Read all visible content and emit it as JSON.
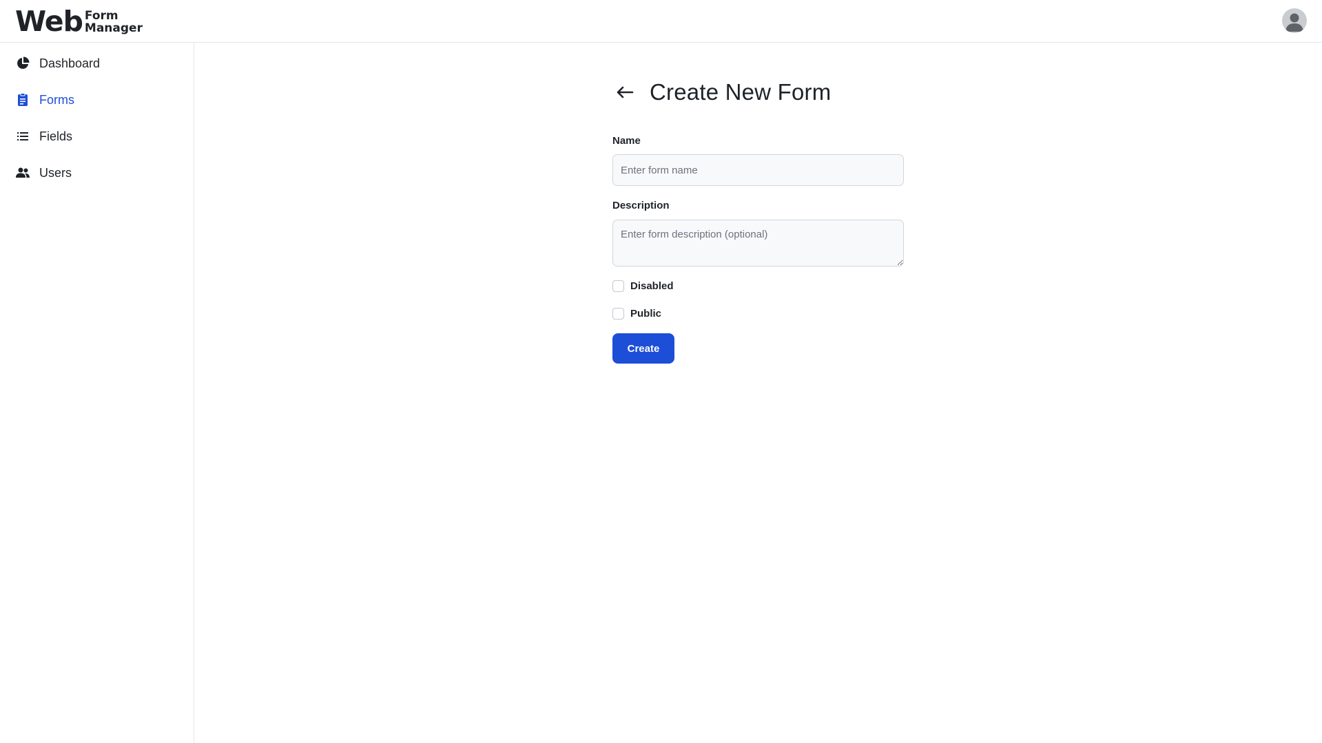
{
  "app": {
    "logo_main": "Web",
    "logo_line1": "Form",
    "logo_line2": "Manager"
  },
  "sidebar": {
    "items": [
      {
        "label": "Dashboard",
        "icon": "pie-chart-icon",
        "active": false
      },
      {
        "label": "Forms",
        "icon": "clipboard-icon",
        "active": true
      },
      {
        "label": "Fields",
        "icon": "list-icon",
        "active": false
      },
      {
        "label": "Users",
        "icon": "users-icon",
        "active": false
      }
    ]
  },
  "colors": {
    "accent": "#1d4ed8",
    "text": "#1f2328",
    "border": "#e5e7eb",
    "input_bg": "#f8f9fa"
  },
  "page": {
    "title": "Create New Form",
    "back_icon": "arrow-left-icon"
  },
  "form": {
    "name_label": "Name",
    "name_value": "",
    "name_placeholder": "Enter form name",
    "description_label": "Description",
    "description_value": "",
    "description_placeholder": "Enter form description (optional)",
    "disabled_label": "Disabled",
    "disabled_checked": false,
    "public_label": "Public",
    "public_checked": false,
    "submit_label": "Create"
  }
}
